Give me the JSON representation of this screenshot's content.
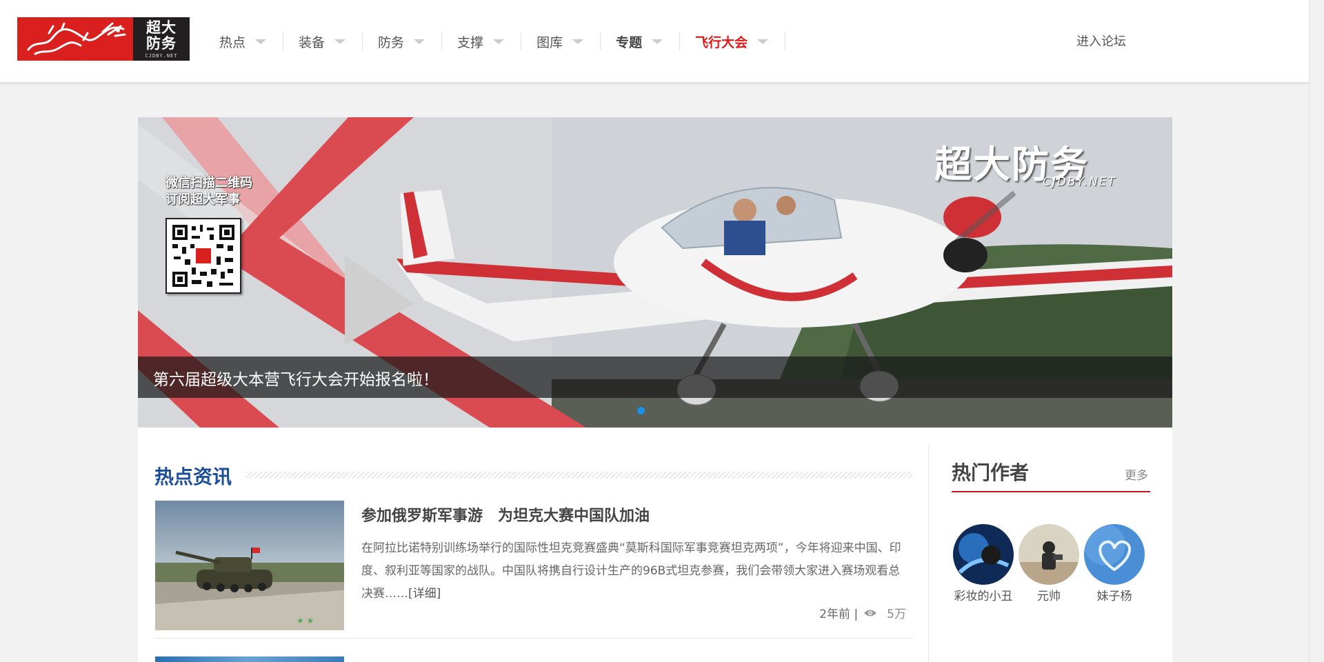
{
  "logo": {
    "line1": "超大",
    "line2": "防务",
    "domain": "CJDBY.NET"
  },
  "nav": {
    "items": [
      {
        "label": "热点"
      },
      {
        "label": "装备"
      },
      {
        "label": "防务"
      },
      {
        "label": "支撑"
      },
      {
        "label": "图库"
      },
      {
        "label": "专题"
      },
      {
        "label": "飞行大会"
      }
    ],
    "forum": "进入论坛"
  },
  "banner": {
    "qr_line1": "微信扫描二维码",
    "qr_line2": "订阅超大军事",
    "brand": "超大防务",
    "brand_sub": "CJDBY.NET",
    "caption": "第六届超级大本营飞行大会开始报名啦！",
    "slide_count": 1,
    "active_dot_color": "#1a8fe8"
  },
  "news": {
    "section_title": "热点资讯",
    "article": {
      "title": "参加俄罗斯军事游　为坦克大赛中国队加油",
      "summary": "在阿拉比诺特别训练场举行的国际性坦克竞赛盛典“莫斯科国际军事竞赛坦克两项”，今年将迎来中国、印度、叙利亚等国家的战队。中国队将携自行设计生产的96B式坦克参赛，我们会带领大家进入赛场观看总决赛……",
      "more": "[详细]",
      "time": "2年前 |",
      "views": "5万"
    }
  },
  "authors": {
    "title": "热门作者",
    "more": "更多",
    "list": [
      {
        "name": "彩妆的小丑"
      },
      {
        "name": "元帅"
      },
      {
        "name": "妹子杨"
      }
    ]
  },
  "colors": {
    "brand_red": "#d9201e",
    "nav_highlight": "#e21a1a",
    "section_blue": "#1d4e9a",
    "side_underline": "#c9141c"
  }
}
